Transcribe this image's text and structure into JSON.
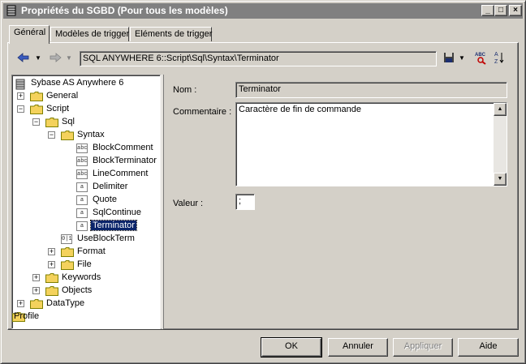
{
  "window": {
    "title": "Propriétés du SGBD (Pour tous les modèles)",
    "controls": [
      "minimize-icon",
      "maximize-icon",
      "close-icon"
    ]
  },
  "tabs": [
    {
      "label": "Général",
      "active": true
    },
    {
      "label": "Modèles de trigger",
      "active": false
    },
    {
      "label": "Eléments de trigger",
      "active": false
    }
  ],
  "toolbar": {
    "path": "SQL ANYWHERE 6::Script\\Sql\\Syntax\\Terminator",
    "icons": [
      "back-arrow-icon",
      "back-dropdown-icon",
      "forward-arrow-icon",
      "forward-dropdown-icon",
      "save-icon",
      "save-dropdown-icon",
      "spell-check-icon",
      "sort-icon"
    ]
  },
  "tree": {
    "root": "Sybase AS Anywhere 6",
    "nodes": [
      {
        "label": "General",
        "type": "folder",
        "expander": "+"
      },
      {
        "label": "Script",
        "type": "folder",
        "expander": "−"
      },
      {
        "label": "Sql",
        "type": "folder",
        "expander": "−"
      },
      {
        "label": "Syntax",
        "type": "folder",
        "expander": "−"
      },
      {
        "label": "BlockComment",
        "type": "abc"
      },
      {
        "label": "BlockTerminator",
        "type": "abc"
      },
      {
        "label": "LineComment",
        "type": "abc"
      },
      {
        "label": "Delimiter",
        "type": "a"
      },
      {
        "label": "Quote",
        "type": "a"
      },
      {
        "label": "SqlContinue",
        "type": "a"
      },
      {
        "label": "Terminator",
        "type": "a",
        "selected": true
      },
      {
        "label": "UseBlockTerm",
        "type": "bool"
      },
      {
        "label": "Format",
        "type": "folder",
        "expander": "+"
      },
      {
        "label": "File",
        "type": "folder",
        "expander": "+"
      },
      {
        "label": "Keywords",
        "type": "folder",
        "expander": "+"
      },
      {
        "label": "Objects",
        "type": "folder",
        "expander": "+"
      },
      {
        "label": "DataType",
        "type": "folder",
        "expander": "+"
      },
      {
        "label": "Profile",
        "type": "folder",
        "expander": "+"
      }
    ],
    "leaf_icon_text": {
      "abc": "abc",
      "a": "a",
      "bool": "0|1"
    }
  },
  "form": {
    "nom_label": "Nom :",
    "nom_value": "Terminator",
    "commentaire_label": "Commentaire :",
    "commentaire_value": "Caractère de fin de commande",
    "valeur_label": "Valeur :",
    "valeur_value": ";"
  },
  "buttons": {
    "ok": "OK",
    "annuler": "Annuler",
    "appliquer": "Appliquer",
    "aide": "Aide"
  },
  "colors": {
    "titlebar": "#808080",
    "face": "#d4d0c8",
    "selection": "#0a246a",
    "folder": "#f4d25c"
  }
}
